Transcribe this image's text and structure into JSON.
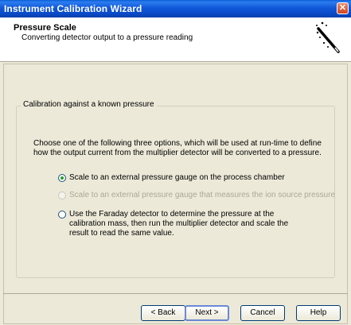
{
  "window": {
    "title": "Instrument Calibration Wizard",
    "close_glyph": "✕"
  },
  "header": {
    "title": "Pressure Scale",
    "subtitle": "Converting detector output to a pressure reading",
    "icon": "magic-wand-icon"
  },
  "group": {
    "caption": "Calibration against a known pressure",
    "description": "Choose one of the following three options, which will be used at run-time to define how the output current from the multiplier detector will be converted to a pressure.",
    "options": [
      {
        "label": "Scale to an external pressure gauge on the process chamber",
        "selected": true,
        "enabled": true
      },
      {
        "label": "Scale to an external pressure gauge that measures the ion source pressure",
        "selected": false,
        "enabled": false
      },
      {
        "label": "Use the Faraday detector to determine the pressure at the calibration mass, then run the multiplier detector and scale the result to read the same value.",
        "selected": false,
        "enabled": true
      }
    ]
  },
  "buttons": {
    "back": "< Back",
    "next": "Next >",
    "cancel": "Cancel",
    "help": "Help"
  },
  "colors": {
    "titlebar": "#0a49c8",
    "dialog_bg": "#ece9d8",
    "radio_dot": "#21a121"
  }
}
